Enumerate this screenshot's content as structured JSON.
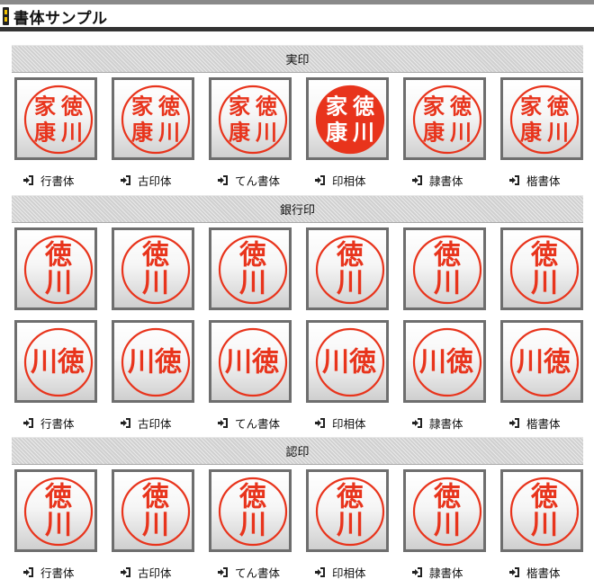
{
  "page_title": "書体サンプル",
  "seal_name": {
    "surname_chars": [
      "徳",
      "川"
    ],
    "given_chars": [
      "家",
      "康"
    ]
  },
  "sections": [
    {
      "heading": "実印",
      "rows": 1,
      "name_style": "full",
      "fonts": [
        "行書体",
        "古印体",
        "てん書体",
        "印相体",
        "隷書体",
        "楷書体"
      ]
    },
    {
      "heading": "銀行印",
      "rows": 2,
      "name_style": "surname",
      "fonts": [
        "行書体",
        "古印体",
        "てん書体",
        "印相体",
        "隷書体",
        "楷書体"
      ]
    },
    {
      "heading": "認印",
      "rows": 1,
      "name_style": "surname",
      "fonts": [
        "行書体",
        "古印体",
        "てん書体",
        "印相体",
        "隷書体",
        "楷書体"
      ]
    }
  ],
  "colors": {
    "seal_red": "#e8341c",
    "band_gray": "#d0d0d0",
    "tile_border": "#6e6e6e",
    "title_rule": "#333333"
  },
  "icons": {
    "label_bullet": "arrow-into-box-icon",
    "title_marker": "title-marker-icon"
  }
}
